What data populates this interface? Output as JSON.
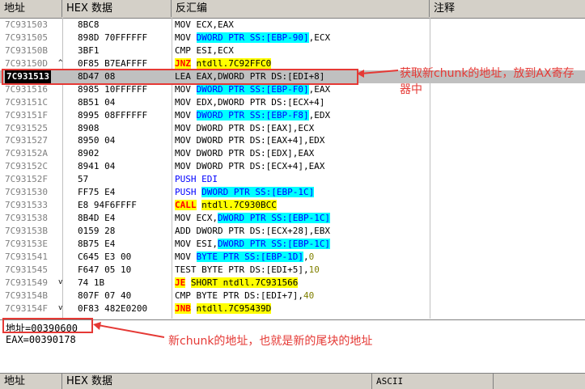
{
  "header": {
    "col_addr": "地址",
    "col_hex": "HEX 数据",
    "col_asm": "反汇编",
    "col_comment": "注释"
  },
  "rows": [
    {
      "addr": "7C931503",
      "arrow": "",
      "hex": "8BC8",
      "asm": [
        {
          "t": "MOV ECX,EAX"
        }
      ]
    },
    {
      "addr": "7C931505",
      "arrow": "",
      "hex": "898D 70FFFFFF",
      "asm": [
        {
          "t": "MOV "
        },
        {
          "t": "DWORD PTR SS:[EBP-90]",
          "c": "hl-cyan"
        },
        {
          "t": ",ECX"
        }
      ]
    },
    {
      "addr": "7C93150B",
      "arrow": "",
      "hex": "3BF1",
      "asm": [
        {
          "t": "CMP ESI,ECX"
        }
      ]
    },
    {
      "addr": "7C93150D",
      "arrow": "^",
      "hex": "0F85 B7EAFFFF",
      "asm": [
        {
          "t": "JNZ",
          "c": "hl-yel"
        },
        {
          "t": " "
        },
        {
          "t": "ntdll.7C92FFC0",
          "c": "hl-yel-dark"
        }
      ]
    },
    {
      "addr": "7C931513",
      "arrow": "",
      "hex": "8D47 08",
      "asm": [
        {
          "t": "LEA EAX,DWORD PTR DS:[EDI+8]"
        }
      ],
      "sel": true
    },
    {
      "addr": "7C931516",
      "arrow": "",
      "hex": "8985 10FFFFFF",
      "asm": [
        {
          "t": "MOV "
        },
        {
          "t": "DWORD PTR SS:[EBP-F0]",
          "c": "hl-cyan"
        },
        {
          "t": ",EAX"
        }
      ]
    },
    {
      "addr": "7C93151C",
      "arrow": "",
      "hex": "8B51 04",
      "asm": [
        {
          "t": "MOV EDX,DWORD PTR DS:[ECX+4]"
        }
      ]
    },
    {
      "addr": "7C93151F",
      "arrow": "",
      "hex": "8995 08FFFFFF",
      "asm": [
        {
          "t": "MOV "
        },
        {
          "t": "DWORD PTR SS:[EBP-F8]",
          "c": "hl-cyan"
        },
        {
          "t": ",EDX"
        }
      ]
    },
    {
      "addr": "7C931525",
      "arrow": "",
      "hex": "8908",
      "asm": [
        {
          "t": "MOV DWORD PTR DS:[EAX],ECX"
        }
      ]
    },
    {
      "addr": "7C931527",
      "arrow": "",
      "hex": "8950 04",
      "asm": [
        {
          "t": "MOV DWORD PTR DS:[EAX+4],EDX"
        }
      ]
    },
    {
      "addr": "7C93152A",
      "arrow": "",
      "hex": "8902",
      "asm": [
        {
          "t": "MOV DWORD PTR DS:[EDX],EAX"
        }
      ]
    },
    {
      "addr": "7C93152C",
      "arrow": "",
      "hex": "8941 04",
      "asm": [
        {
          "t": "MOV DWORD PTR DS:[ECX+4],EAX"
        }
      ]
    },
    {
      "addr": "7C93152F",
      "arrow": "",
      "hex": "57",
      "asm": [
        {
          "t": "PUSH EDI",
          "c": "blue"
        }
      ]
    },
    {
      "addr": "7C931530",
      "arrow": "",
      "hex": "FF75 E4",
      "asm": [
        {
          "t": "PUSH ",
          "c": "blue"
        },
        {
          "t": "DWORD PTR SS:[EBP-1C]",
          "c": "hl-cyan"
        }
      ]
    },
    {
      "addr": "7C931533",
      "arrow": "",
      "hex": "E8 94F6FFFF",
      "asm": [
        {
          "t": "CALL",
          "c": "hl-yel"
        },
        {
          "t": " "
        },
        {
          "t": "ntdll.7C930BCC",
          "c": "hl-yel-dark"
        }
      ]
    },
    {
      "addr": "7C931538",
      "arrow": "",
      "hex": "8B4D E4",
      "asm": [
        {
          "t": "MOV ECX,"
        },
        {
          "t": "DWORD PTR SS:[EBP-1C]",
          "c": "hl-cyan"
        }
      ]
    },
    {
      "addr": "7C93153B",
      "arrow": "",
      "hex": "0159 28",
      "asm": [
        {
          "t": "ADD DWORD PTR DS:[ECX+28],EBX"
        }
      ]
    },
    {
      "addr": "7C93153E",
      "arrow": "",
      "hex": "8B75 E4",
      "asm": [
        {
          "t": "MOV ESI,"
        },
        {
          "t": "DWORD PTR SS:[EBP-1C]",
          "c": "hl-cyan"
        }
      ]
    },
    {
      "addr": "7C931541",
      "arrow": "",
      "hex": "C645 E3 00",
      "asm": [
        {
          "t": "MOV "
        },
        {
          "t": "BYTE PTR SS:[EBP-1D]",
          "c": "hl-cyan"
        },
        {
          "t": ","
        },
        {
          "t": "0",
          "c": "olive"
        }
      ]
    },
    {
      "addr": "7C931545",
      "arrow": "",
      "hex": "F647 05 10",
      "asm": [
        {
          "t": "TEST BYTE PTR DS:[EDI+5],"
        },
        {
          "t": "10",
          "c": "olive"
        }
      ]
    },
    {
      "addr": "7C931549",
      "arrow": "v",
      "hex": "74 1B",
      "asm": [
        {
          "t": "JE",
          "c": "hl-yel"
        },
        {
          "t": " "
        },
        {
          "t": "SHORT ntdll.7C931566",
          "c": "hl-yel-dark"
        }
      ]
    },
    {
      "addr": "7C93154B",
      "arrow": "",
      "hex": "807F 07 40",
      "asm": [
        {
          "t": "CMP BYTE PTR DS:[EDI+7],"
        },
        {
          "t": "40",
          "c": "olive"
        }
      ]
    },
    {
      "addr": "7C93154F",
      "arrow": "v",
      "hex": "0F83 482E0200",
      "asm": [
        {
          "t": "JNB",
          "c": "hl-yel"
        },
        {
          "t": " "
        },
        {
          "t": "ntdll.7C95439D",
          "c": "hl-yel-dark"
        }
      ]
    }
  ],
  "info": {
    "line1": "地址=00390600",
    "line2": "EAX=00390178"
  },
  "dump_header": {
    "col_addr": "地址",
    "col_hex": "HEX 数据",
    "col_ascii": "ASCII"
  },
  "annotations": {
    "a1": "获取新chunk的地址，放到AX寄存器中",
    "a2": "新chunk的地址，也就是新的尾块的地址"
  },
  "colors": {
    "red": "#e53935",
    "cyan": "#00ffff",
    "yellow": "#ffff00",
    "selection": "#c0c0c0"
  }
}
